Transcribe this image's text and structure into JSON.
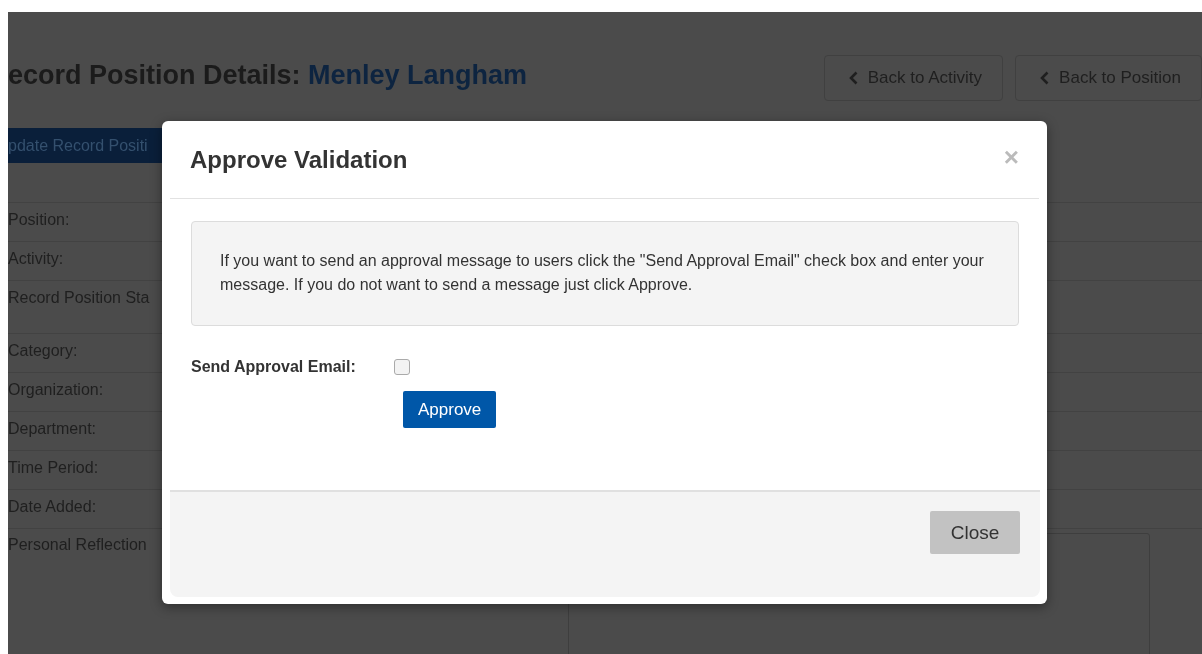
{
  "page": {
    "title": "ecord Position Details:",
    "title_name": "Menley Langham",
    "nav_buttons": [
      "Back to Activity",
      "Back to Position"
    ],
    "update_button": "pdate Record Positi",
    "fields": [
      {
        "label": "Position:"
      },
      {
        "label": "Activity:"
      },
      {
        "label": "Record Position Sta",
        "kind": "tall"
      },
      {
        "label": "Category:"
      },
      {
        "label": "Organization:"
      },
      {
        "label": "Department:"
      },
      {
        "label": "Time Period:"
      },
      {
        "label": "Date Added:"
      },
      {
        "label": "Personal Reflection",
        "kind": "textarea"
      }
    ]
  },
  "dialog": {
    "title": "Approve Validation",
    "close_icon": "×",
    "message": "If you want to send an approval message to users click the \"Send Approval Email\" check box and enter your message. If you do not want to send a message just click Approve.",
    "send_email": {
      "label": "Send Approval Email:",
      "checked": false
    },
    "approve_button": "Approve",
    "close_button": "Close"
  }
}
